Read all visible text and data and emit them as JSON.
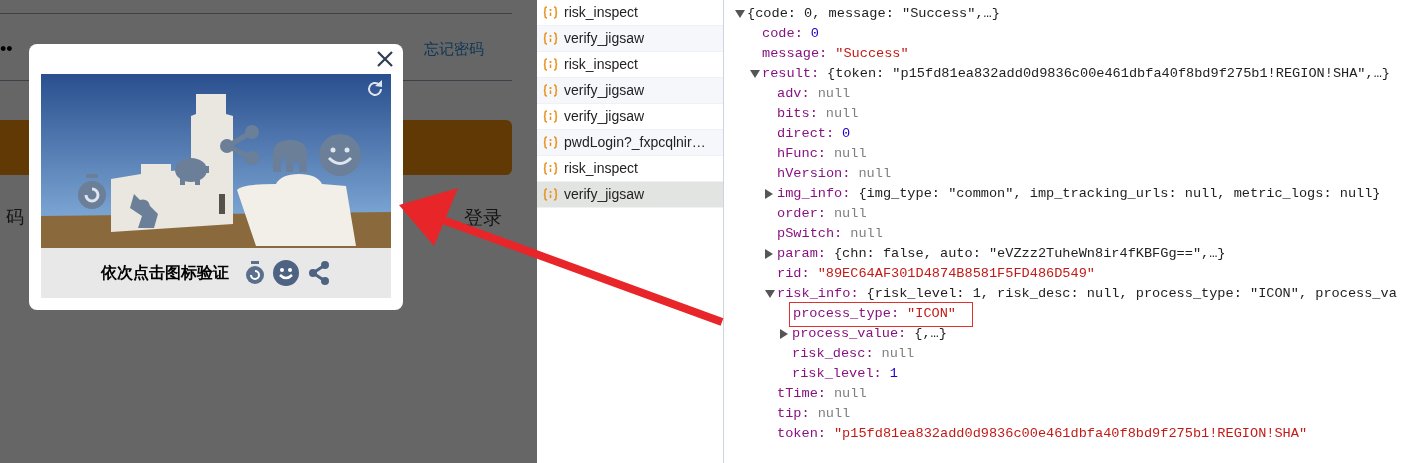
{
  "login_page": {
    "password_value": "••",
    "forgot_password_link": "忘记密码",
    "left_text": "码",
    "right_text": "登录"
  },
  "captcha": {
    "instruction": "依次点击图标验证"
  },
  "network": {
    "requests": [
      {
        "name": "risk_inspect",
        "selected": false
      },
      {
        "name": "verify_jigsaw",
        "selected": false
      },
      {
        "name": "risk_inspect",
        "selected": false
      },
      {
        "name": "verify_jigsaw",
        "selected": false
      },
      {
        "name": "verify_jigsaw",
        "selected": false
      },
      {
        "name": "pwdLogin?_fxpcqlnir…",
        "selected": false
      },
      {
        "name": "risk_inspect",
        "selected": false
      },
      {
        "name": "verify_jigsaw",
        "selected": true
      }
    ]
  },
  "response": {
    "tree": [
      {
        "value": "{code: 0, message: \"Success\",…}",
        "kind": "preview",
        "expanded": true,
        "children": [
          {
            "key": "code:",
            "value": "0",
            "kind": "number"
          },
          {
            "key": "message:",
            "value": "\"Success\"",
            "kind": "string"
          },
          {
            "key": "result:",
            "value": "{token: \"p15fd81ea832add0d9836c00e461dbfa40f8bd9f275b1!REGION!SHA\",…}",
            "kind": "preview",
            "expanded": true,
            "children": [
              {
                "key": "adv:",
                "value": "null",
                "kind": "null"
              },
              {
                "key": "bits:",
                "value": "null",
                "kind": "null"
              },
              {
                "key": "direct:",
                "value": "0",
                "kind": "number"
              },
              {
                "key": "hFunc:",
                "value": "null",
                "kind": "null"
              },
              {
                "key": "hVersion:",
                "value": "null",
                "kind": "null"
              },
              {
                "key": "img_info:",
                "value": "{img_type: \"common\", imp_tracking_urls: null, metric_logs: null}",
                "kind": "preview",
                "expanded": false
              },
              {
                "key": "order:",
                "value": "null",
                "kind": "null"
              },
              {
                "key": "pSwitch:",
                "value": "null",
                "kind": "null"
              },
              {
                "key": "param:",
                "value": "{chn: false, auto: \"eVZzz2TuheWn8ir4fKBFGg==\",…}",
                "kind": "preview",
                "expanded": false
              },
              {
                "key": "rid:",
                "value": "\"89EC64AF301D4874B8581F5FD486D549\"",
                "kind": "string"
              },
              {
                "key": "risk_info:",
                "value": "{risk_level: 1, risk_desc: null, process_type: \"ICON\", process_va",
                "kind": "preview",
                "expanded": true,
                "children": [
                  {
                    "key": "process_type:",
                    "value": "\"ICON\"",
                    "kind": "string",
                    "annotated": true
                  },
                  {
                    "key": "process_value:",
                    "value": "{,…}",
                    "kind": "preview",
                    "expanded": false
                  },
                  {
                    "key": "risk_desc:",
                    "value": "null",
                    "kind": "null"
                  },
                  {
                    "key": "risk_level:",
                    "value": "1",
                    "kind": "number"
                  }
                ]
              },
              {
                "key": "tTime:",
                "value": "null",
                "kind": "null"
              },
              {
                "key": "tip:",
                "value": "null",
                "kind": "null"
              },
              {
                "key": "token:",
                "value": "\"p15fd81ea832add0d9836c00e461dbfa40f8bd9f275b1!REGION!SHA\"",
                "kind": "string"
              }
            ]
          }
        ]
      }
    ]
  }
}
